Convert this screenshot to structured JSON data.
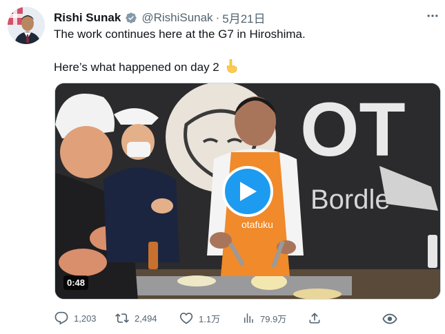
{
  "author": {
    "display_name": "Rishi Sunak",
    "handle": "@RishiSunak",
    "separator": "·",
    "date": "5月21日"
  },
  "tweet": {
    "line1": "The work continues here at the G7 in Hiroshima.",
    "line2": "Here’s what happened on day 2",
    "emoji": "pointing-down-emoji"
  },
  "media": {
    "type": "video",
    "duration": "0:48",
    "apron_text": "otafuku",
    "sign_text": "OT",
    "sign_text_2": "Bord",
    "sign_text_3": "le"
  },
  "actions": {
    "replies": "1,203",
    "retweets": "2,494",
    "likes": "1.1万",
    "views": "79.9万"
  },
  "colors": {
    "accent": "#1d9bf0",
    "muted": "#536471",
    "text": "#0f1419"
  }
}
